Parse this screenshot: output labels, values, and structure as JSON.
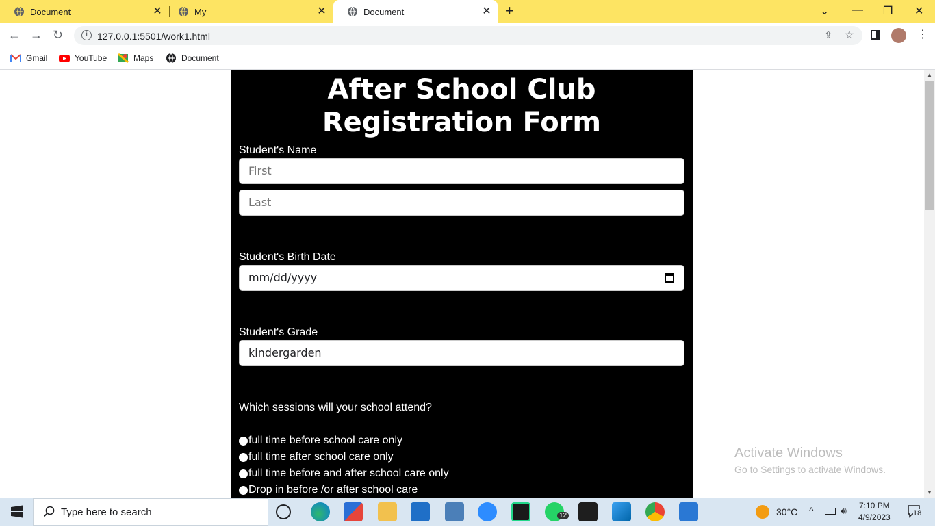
{
  "browser": {
    "tabs": [
      {
        "title": "Document",
        "active": false
      },
      {
        "title": "My",
        "active": false
      },
      {
        "title": "Document",
        "active": true
      }
    ],
    "new_tab": "+",
    "url": "127.0.0.1:5501/work1.html",
    "bookmarks": [
      {
        "label": "Gmail",
        "icon": "gmail-icon"
      },
      {
        "label": "YouTube",
        "icon": "youtube-icon"
      },
      {
        "label": "Maps",
        "icon": "maps-icon"
      },
      {
        "label": "Document",
        "icon": "globe-icon"
      }
    ]
  },
  "form": {
    "title": "After School Club Registration Form",
    "name_label": "Student's Name",
    "first_placeholder": "First",
    "last_placeholder": "Last",
    "birth_label": "Student's Birth Date",
    "birth_placeholder": "mm/dd/yyyy",
    "grade_label": "Student's Grade",
    "grade_value": "kindergarden",
    "sessions_question": "Which sessions will your school attend?",
    "session_options": [
      "full time before school care only",
      "full time after school care only",
      "full time before and after school care only",
      "Drop in before /or after school care"
    ]
  },
  "watermark": {
    "line1": "Activate Windows",
    "line2": "Go to Settings to activate Windows."
  },
  "taskbar": {
    "search_placeholder": "Type here to search",
    "whatsapp_badge": "12",
    "temperature": "30°C",
    "time": "7:10 PM",
    "date": "4/9/2023",
    "notification_count": "18"
  },
  "colors": {
    "tabbar": "#fde463",
    "form_bg": "#000000",
    "taskbar": "#d9e6f2"
  }
}
